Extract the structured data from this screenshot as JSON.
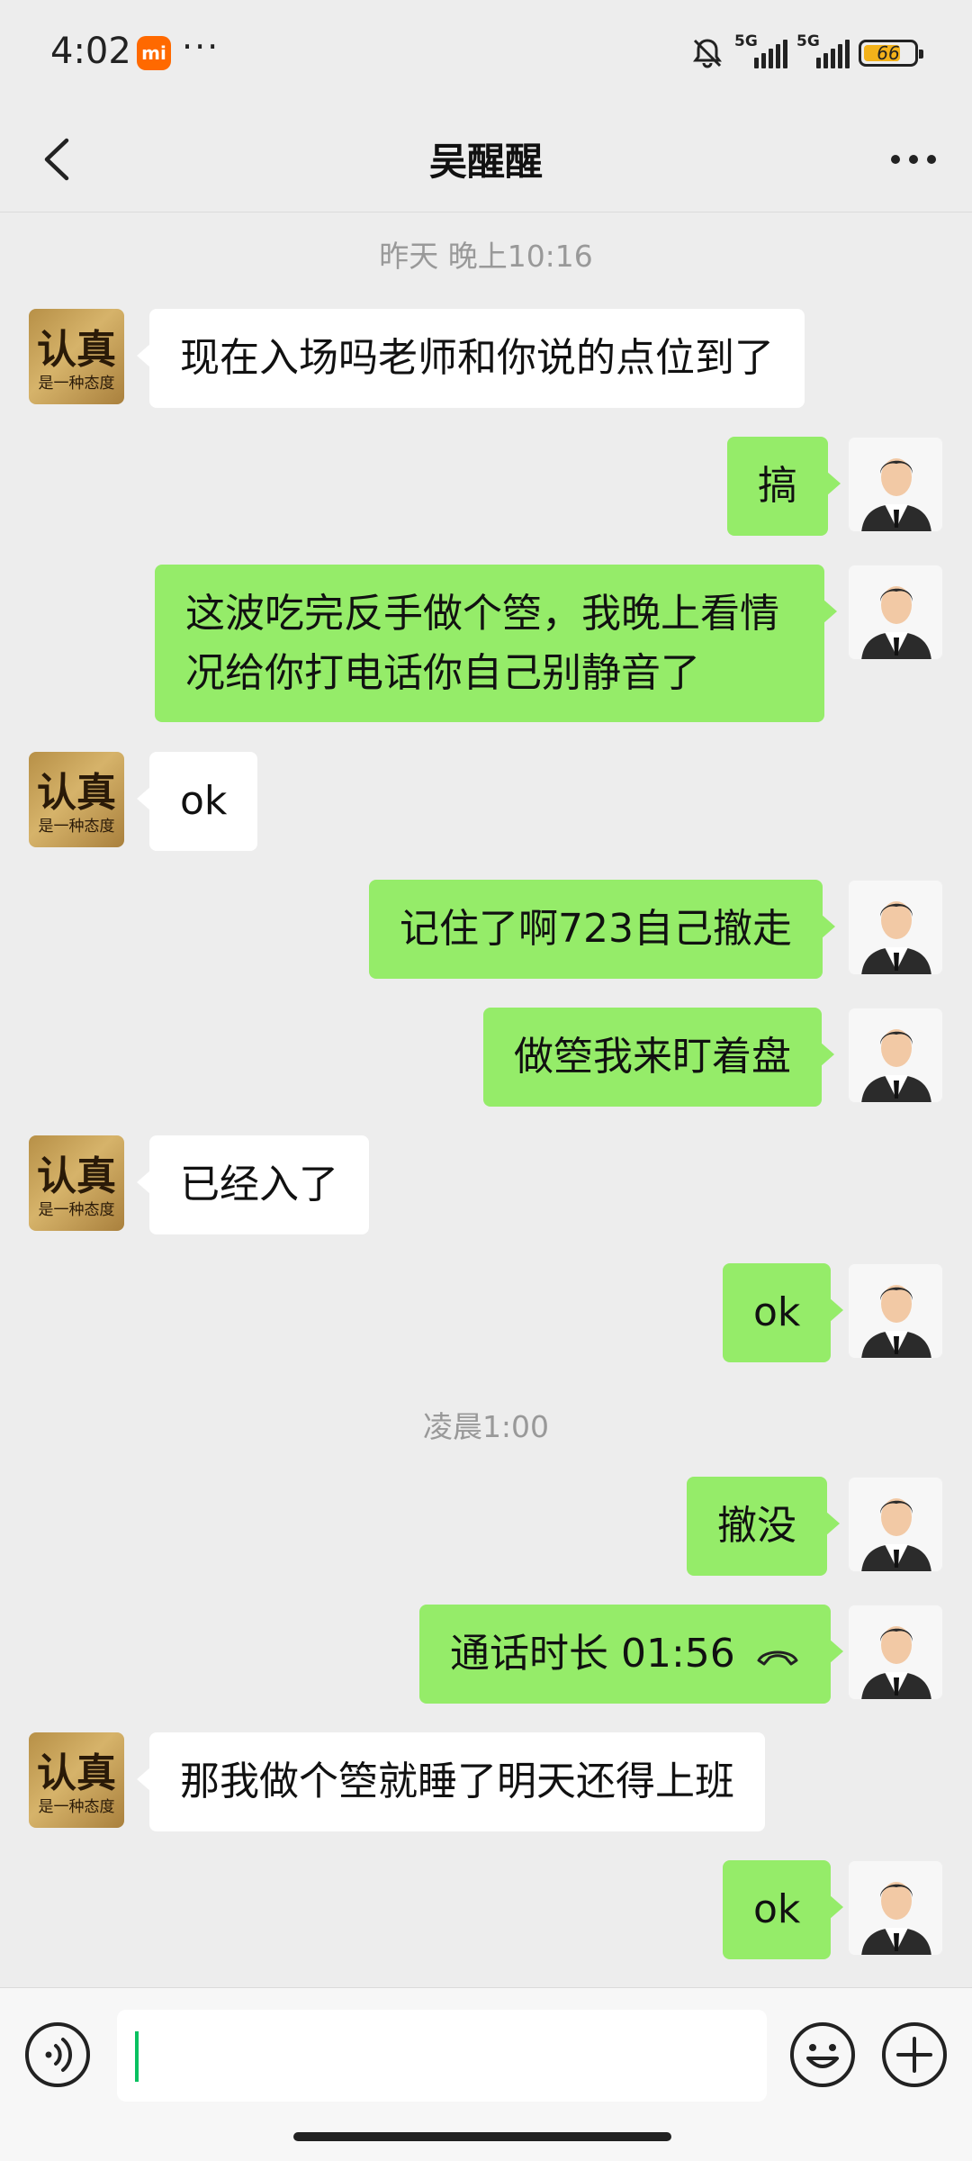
{
  "status_bar": {
    "time": "4:02",
    "notification_dots": "···",
    "network_1": "5G",
    "network_2": "5G",
    "battery_level": "66"
  },
  "header": {
    "title": "吴醒醒"
  },
  "timestamps": {
    "yesterday": "昨天 晚上10:16",
    "early_morning": "凌晨1:00"
  },
  "messages": [
    {
      "side": "in",
      "text": "现在入场吗老师和你说的点位到了"
    },
    {
      "side": "out",
      "text": "搞"
    },
    {
      "side": "out",
      "line1": "这波吃完反手做个箜，我晚上看情",
      "line2": "况给你打电话你自己别静音了"
    },
    {
      "side": "in",
      "text": "ok"
    },
    {
      "side": "out",
      "text": "记住了啊723自己撤走"
    },
    {
      "side": "out",
      "text": "做箜我来盯着盘"
    },
    {
      "side": "in",
      "text": "已经入了"
    },
    {
      "side": "out",
      "text": "ok"
    },
    {
      "side": "out",
      "text": "撤没"
    },
    {
      "side": "out",
      "text": "通话时长  01:56",
      "icon": "phone-hangup-icon"
    },
    {
      "side": "in",
      "text": "那我做个箜就睡了明天还得上班"
    },
    {
      "side": "out",
      "text": "ok"
    }
  ],
  "avatars": {
    "other_text_top": "认真",
    "other_text_bottom": "是一种态度"
  },
  "colors": {
    "out_bubble": "#95ec69",
    "in_bubble": "#ffffff",
    "background": "#ededed",
    "cursor": "#07c160",
    "mi_badge": "#ff6900",
    "battery": "#f3b21a"
  }
}
